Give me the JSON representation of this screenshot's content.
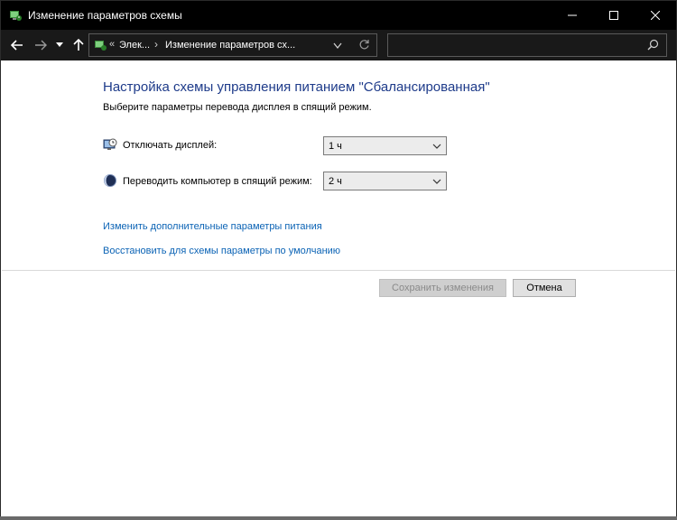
{
  "window": {
    "title": "Изменение параметров схемы",
    "controls": [
      "minimize-icon",
      "maximize-icon",
      "close-icon"
    ]
  },
  "navigation": {
    "back_icon": "arrow-left-icon",
    "forward_icon": "arrow-right-icon",
    "recent_icon": "chevron-down-icon",
    "up_icon": "arrow-up-icon",
    "address": {
      "overflow": "«",
      "crumb_1": "Элек...",
      "separator": "›",
      "crumb_2": "Изменение параметров сх...",
      "dropdown_icon": "chevron-down-icon",
      "refresh_icon": "refresh-icon"
    },
    "search": {
      "placeholder": "",
      "icon": "search-icon"
    }
  },
  "main": {
    "heading": "Настройка схемы управления питанием \"Сбалансированная\"",
    "subtitle": "Выберите параметры перевода дисплея в спящий режим.",
    "display_off": {
      "label": "Отключать дисплей:",
      "value": "1 ч",
      "icon": "monitor-clock-icon"
    },
    "sleep": {
      "label": "Переводить компьютер в спящий режим:",
      "value": "2 ч",
      "icon": "moon-icon"
    },
    "links": {
      "advanced": "Изменить дополнительные параметры питания",
      "restore": "Восстановить для схемы параметры по умолчанию"
    },
    "buttons": {
      "save": "Сохранить изменения",
      "cancel": "Отмена"
    }
  },
  "colors": {
    "heading": "#1e3b8a",
    "link": "#0b63b5",
    "titlebar": "#000000"
  }
}
